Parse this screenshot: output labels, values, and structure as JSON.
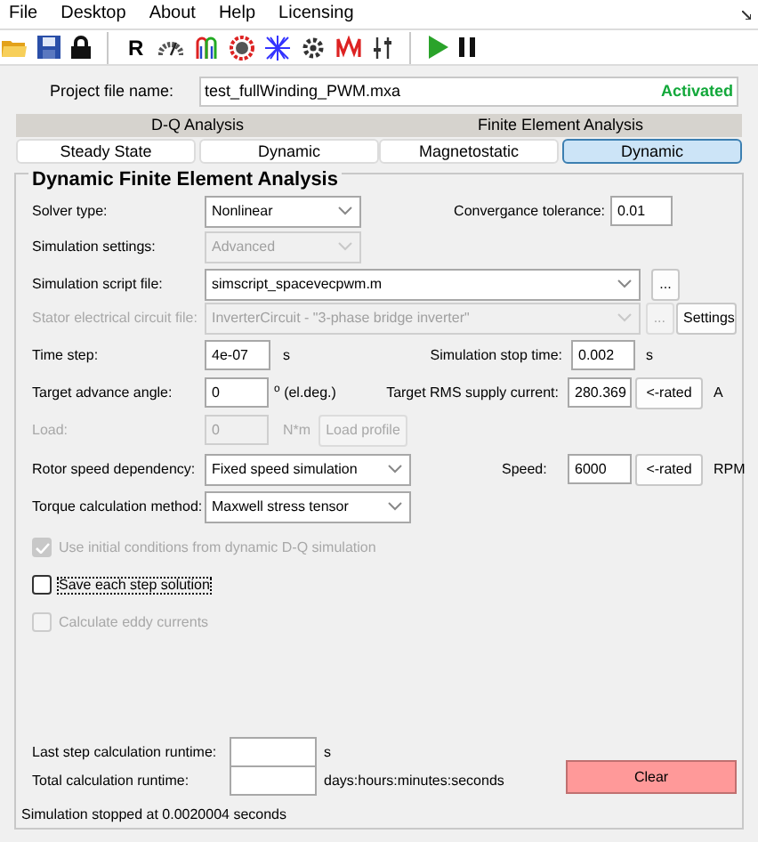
{
  "menu": [
    "File",
    "Desktop",
    "About",
    "Help",
    "Licensing"
  ],
  "toolbar": [
    {
      "kind": "folder"
    },
    {
      "kind": "save"
    },
    {
      "kind": "lock"
    },
    {
      "kind": "separator"
    },
    {
      "kind": "letter",
      "text": "R"
    },
    {
      "kind": "gauge"
    },
    {
      "kind": "coil"
    },
    {
      "kind": "ring"
    },
    {
      "kind": "mesh"
    },
    {
      "kind": "gear"
    },
    {
      "kind": "wave"
    },
    {
      "kind": "sliders"
    },
    {
      "kind": "separator"
    },
    {
      "kind": "play"
    },
    {
      "kind": "pause"
    }
  ],
  "project": {
    "label": "Project file name:",
    "value": "test_fullWinding_PWM.mxa",
    "status": "Activated"
  },
  "tab_groups": [
    {
      "title": "D-Q Analysis",
      "tabs": [
        {
          "label": "Steady State",
          "selected": false
        },
        {
          "label": "Dynamic",
          "selected": false
        }
      ]
    },
    {
      "title": "Finite Element Analysis",
      "tabs": [
        {
          "label": "Magnetostatic",
          "selected": false
        },
        {
          "label": "Dynamic",
          "selected": true
        }
      ]
    }
  ],
  "panel": {
    "title": "Dynamic Finite Element Analysis",
    "solver_type": {
      "label": "Solver type:",
      "value": "Nonlinear",
      "disabled": false
    },
    "convergence": {
      "label": "Convergance tolerance:",
      "value": "0.01"
    },
    "simulation_settings": {
      "label": "Simulation settings:",
      "value": "Advanced",
      "disabled": true
    },
    "script_file": {
      "label": "Simulation script file:",
      "value": "simscript_spacevecpwm.m",
      "disabled": false,
      "browse": "..."
    },
    "stator_circuit": {
      "label": "Stator electrical circuit file:",
      "value": "InverterCircuit - \"3-phase bridge inverter\"",
      "disabled": true,
      "browse": "...",
      "settings": "Settings"
    },
    "time_step": {
      "label": "Time step:",
      "value": "4e-07",
      "unit": "s"
    },
    "stop_time": {
      "label": "Simulation stop time:",
      "value": "0.002",
      "unit": "s"
    },
    "advance_angle": {
      "label": "Target advance angle:",
      "value": "0",
      "unit": "$^{o}$ (el.deg.)"
    },
    "rms_current": {
      "label": "Target RMS supply current:",
      "value": "280.369",
      "button": "<-rated",
      "unit": "A"
    },
    "load": {
      "label": "Load:",
      "value": "0",
      "unit": "N*m",
      "button": "Load profile",
      "disabled": true
    },
    "rotor_speed": {
      "label": "Rotor speed dependency:",
      "value": "Fixed speed simulation",
      "disabled": false
    },
    "speed": {
      "label": "Speed:",
      "value": "6000",
      "button": "<-rated",
      "unit": "RPM"
    },
    "torque_method": {
      "label": "Torque calculation method:",
      "value": "Maxwell stress tensor",
      "disabled": false
    },
    "checkboxes": [
      {
        "label": "Use initial conditions from dynamic D-Q simulation",
        "checked": true,
        "disabled": true,
        "focused": false
      },
      {
        "label": "Save each step solution",
        "checked": false,
        "disabled": false,
        "focused": true
      },
      {
        "label": "Calculate eddy currents",
        "checked": false,
        "disabled": true,
        "focused": false
      }
    ],
    "last_step_runtime": {
      "label": "Last step calculation runtime:",
      "unit": "s"
    },
    "total_runtime": {
      "label": "Total calculation runtime:",
      "unit": "days:hours:minutes:seconds"
    },
    "clear_button": "Clear",
    "status": "Simulation stopped at 0.0020004 seconds"
  }
}
